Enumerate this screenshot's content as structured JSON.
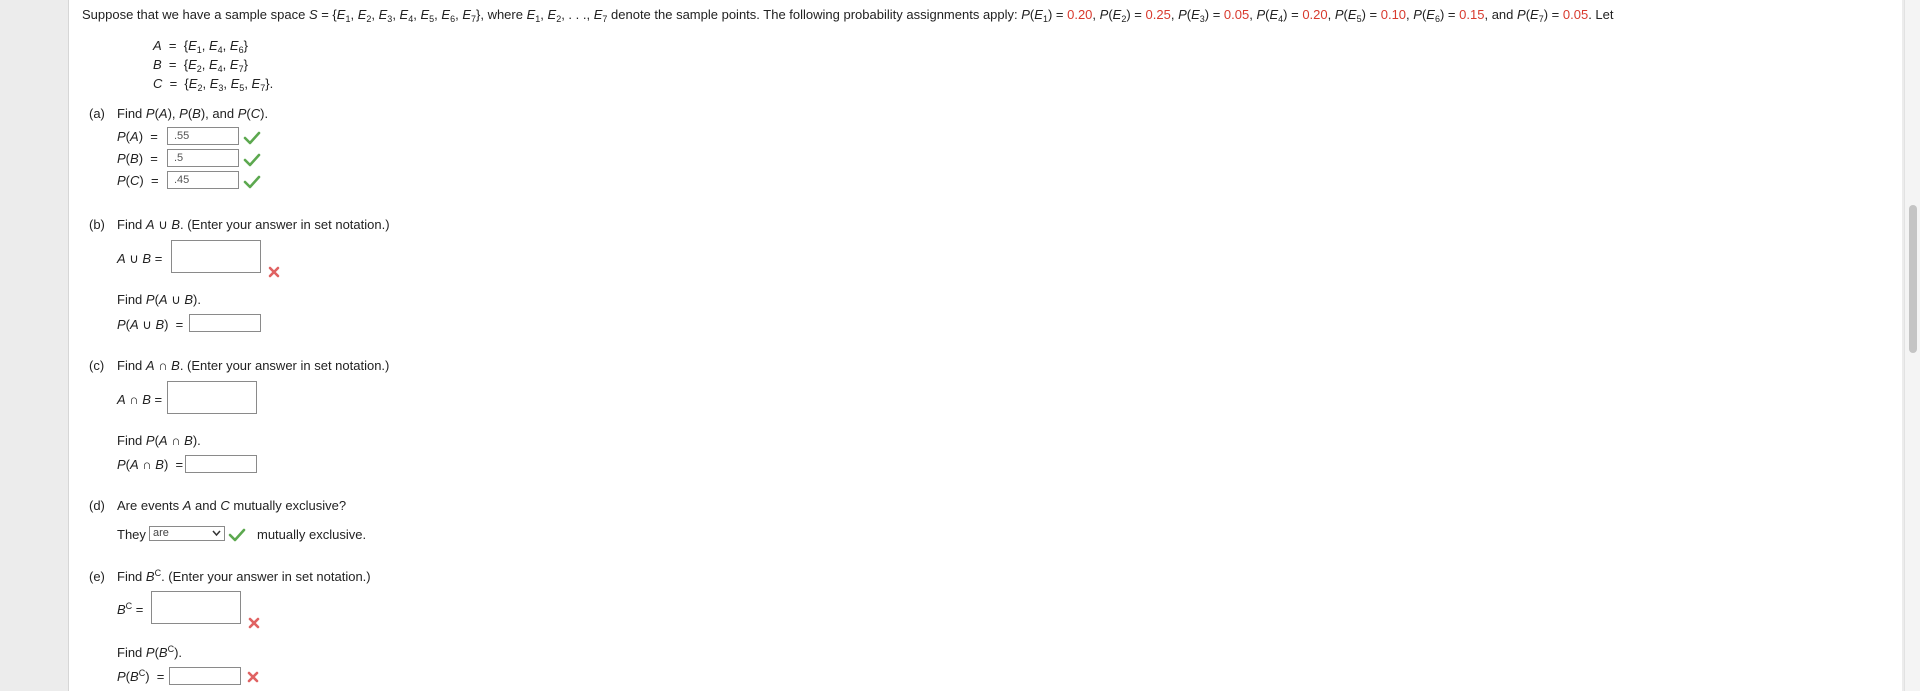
{
  "intro": {
    "t1": "Suppose that we have a sample space ",
    "t2": ", where ",
    "t3": " denote the sample points. The following probability assignments apply: ",
    "t_and": "and",
    "t_let": ". Let",
    "p1": "0.20",
    "p2": "0.25",
    "p3": "0.05",
    "p4": "0.20",
    "p5": "0.10",
    "p6": "0.15",
    "p7": "0.05"
  },
  "sets": {
    "A": "{E1, E4, E6}",
    "B": "{E2, E4, E7}",
    "C": "{E2, E3, E5, E7}."
  },
  "part_a": {
    "label": "(a)",
    "prompt": "Find P(A), P(B), and P(C).",
    "pa_label": "P(A) =",
    "pb_label": "P(B) =",
    "pc_label": "P(C) =",
    "pa_value": ".55",
    "pb_value": ".5",
    "pc_value": ".45"
  },
  "part_b": {
    "label": "(b)",
    "prompt": "Find A ∪ B. (Enter your answer in set notation.)",
    "set_label": "A ∪ B =",
    "set_value": "",
    "prob_prompt": "Find P(A ∪ B).",
    "prob_label": "P(A ∪ B) =",
    "prob_value": ""
  },
  "part_c": {
    "label": "(c)",
    "prompt": "Find A ∩ B. (Enter your answer in set notation.)",
    "set_label": "A ∩ B =",
    "set_value": "",
    "prob_prompt": "Find P(A ∩ B).",
    "prob_label": "P(A ∩ B) =",
    "prob_value": ""
  },
  "part_d": {
    "label": "(d)",
    "prompt": "Are events A and C mutually exclusive?",
    "they": "They",
    "selected": "are",
    "suffix": "mutually exclusive."
  },
  "part_e": {
    "label": "(e)",
    "prompt": "Find B^C. (Enter your answer in set notation.)",
    "set_label": "B^C =",
    "set_value": "",
    "prob_prompt": "Find P(B^C).",
    "prob_label": "P(B^C) =",
    "prob_value": ""
  },
  "colors": {
    "accent_red": "#d83a2e",
    "check_green": "#5ca84f",
    "cross_red": "#e06262"
  }
}
